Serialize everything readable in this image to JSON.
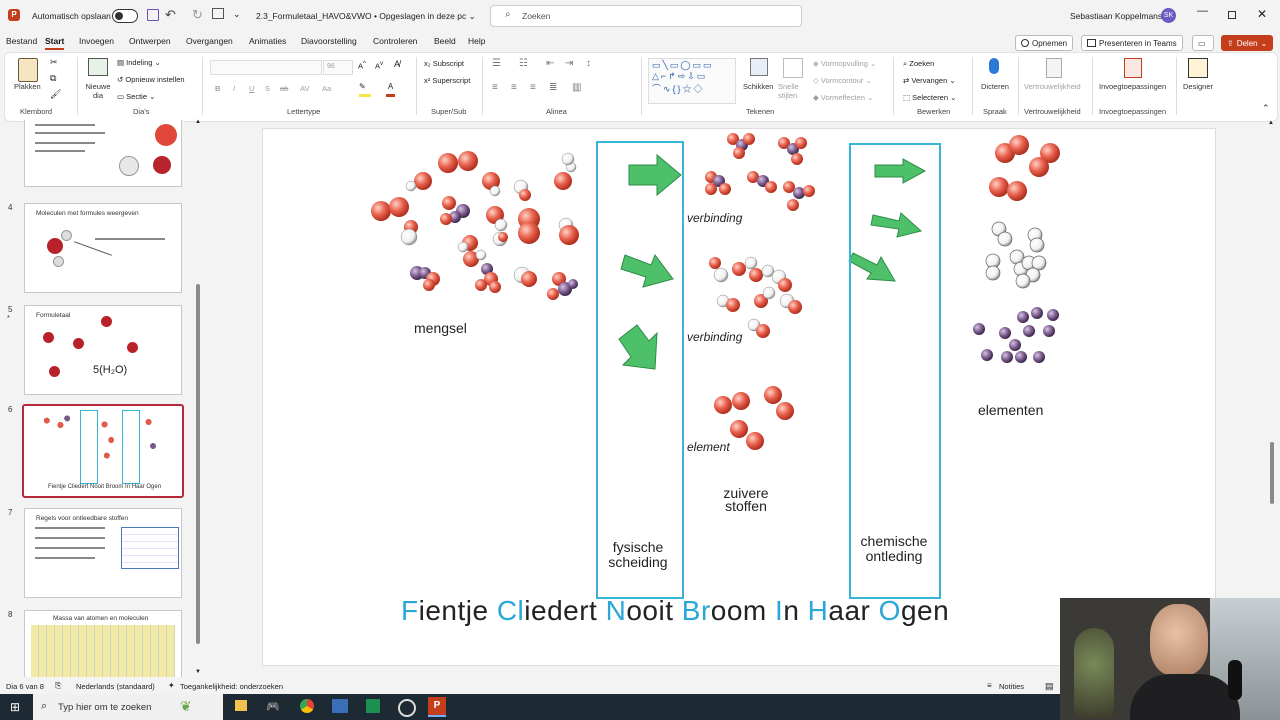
{
  "titlebar": {
    "autosave_label": "Automatisch opslaan",
    "doc_title": "2.3_Formuletaal_HAVO&VWO • Opgeslagen in deze pc ⌄",
    "search_placeholder": "Zoeken",
    "user_name": "Sebastiaan Koppelmans",
    "user_initials": "SK"
  },
  "menu": {
    "tabs": [
      "Bestand",
      "Start",
      "Invoegen",
      "Ontwerpen",
      "Overgangen",
      "Animaties",
      "Diavoorstelling",
      "Controleren",
      "Beeld",
      "Help"
    ],
    "opnemen": "Opnemen",
    "presenteren": "Presenteren in Teams",
    "delen": "Delen"
  },
  "ribbon": {
    "plakken": "Plakken",
    "klembord": "Klembord",
    "nieuwe_dia": "Nieuwe dia",
    "indeling": "Indeling",
    "opnieuw": "Opnieuw instellen",
    "sectie": "Sectie",
    "dias": "Dia's",
    "lettertype": "Lettertype",
    "font_size": "96",
    "subscript": "Subscript",
    "superscript": "Superscript",
    "superSub": "Super/Sub",
    "alinea": "Alinea",
    "schikken": "Schikken",
    "snelle_stijlen": "Snelle stijlen",
    "vormopvulling": "Vormopvulling",
    "vormcontour": "Vormcontour",
    "vormeffecten": "Vormeffecten",
    "tekenen": "Tekenen",
    "zoeken": "Zoeken",
    "vervangen": "Vervangen",
    "selecteren": "Selecteren",
    "bewerken": "Bewerken",
    "dicteren": "Dicteren",
    "spraak": "Spraak",
    "vertrouwelijkheid": "Vertrouwelijkheid",
    "invoegtoepassingen": "Invoegtoepassingen",
    "designer": "Designer"
  },
  "thumbs": [
    {
      "num": "4",
      "title": "Moleculen met formules weergeven"
    },
    {
      "num": "5",
      "title": "Formuletaal",
      "formula": "5(H₂O)"
    },
    {
      "num": "6",
      "caption": "Fientje Cliedert Nooit Broom In Haar Ogen"
    },
    {
      "num": "7",
      "title": "Regels voor ontleedbare stoffen"
    },
    {
      "num": "8",
      "title": "Massa van atomen en moleculen"
    }
  ],
  "slide": {
    "mengsel": "mengsel",
    "verbinding1": "verbinding",
    "verbinding2": "verbinding",
    "element": "element",
    "zuivere_stoffen": "zuivere stoffen",
    "fysische_scheiding": "fysische scheiding",
    "chemische_ontleding": "chemische ontleding",
    "elementen": "elementen",
    "mnemonic": [
      {
        "h": "F",
        "r": "ientje "
      },
      {
        "h": "Cl",
        "r": "iedert "
      },
      {
        "h": "N",
        "r": "ooit "
      },
      {
        "h": "Br",
        "r": "oom "
      },
      {
        "h": "I",
        "r": "n "
      },
      {
        "h": "H",
        "r": "aar "
      },
      {
        "h": "O",
        "r": "gen"
      }
    ]
  },
  "status": {
    "dia": "Dia 6 van 8",
    "taal": "Nederlands (standaard)",
    "toegankelijkheid": "Toegankelijkheid: onderzoeken",
    "notities": "Notities"
  },
  "taskbar": {
    "search_placeholder": "Typ hier om te zoeken"
  },
  "colors": {
    "accent": "#c43e1c",
    "cyan": "#37b4d6",
    "arrow": "#4fc06a",
    "atom_red": "#e25a4a",
    "atom_purple": "#7a5a8c"
  }
}
